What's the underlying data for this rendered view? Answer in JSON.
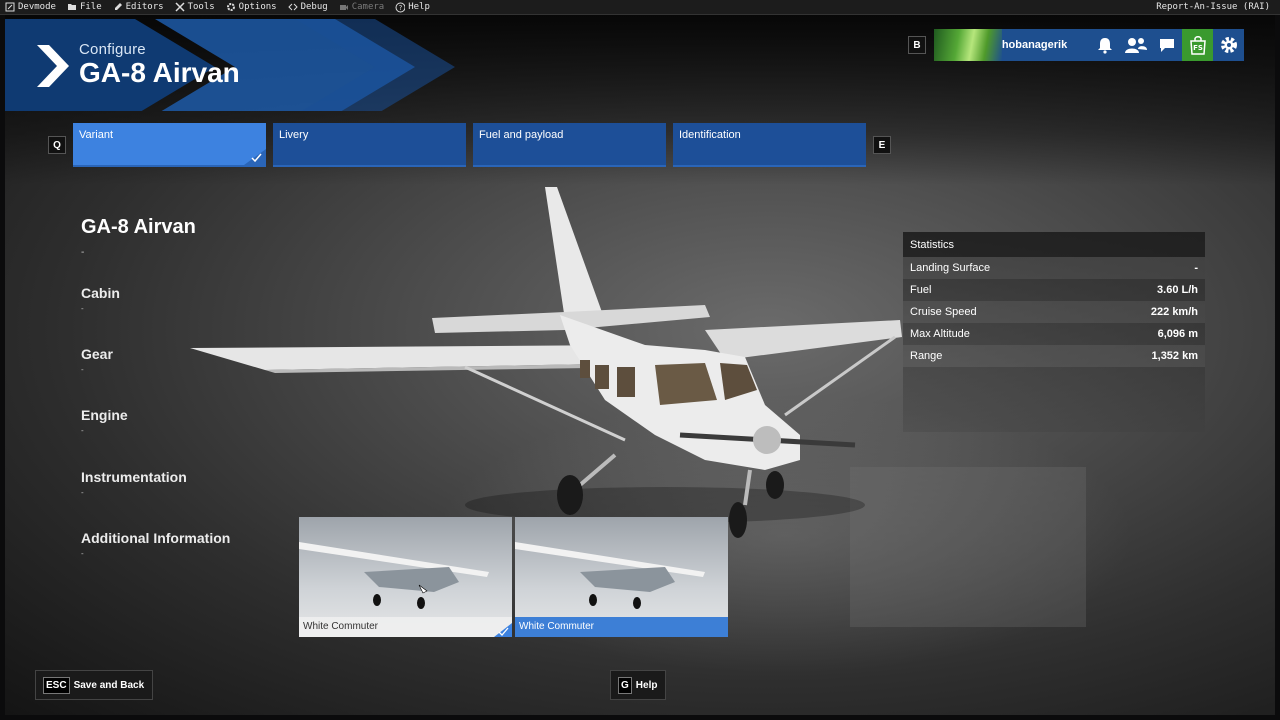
{
  "devbar": {
    "menus": [
      {
        "icon": "devmode-icon",
        "label": "Devmode",
        "enabled": true
      },
      {
        "icon": "folder-icon",
        "label": "File",
        "enabled": true
      },
      {
        "icon": "pencil-icon",
        "label": "Editors",
        "enabled": true
      },
      {
        "icon": "tools-icon",
        "label": "Tools",
        "enabled": true
      },
      {
        "icon": "gear-icon",
        "label": "Options",
        "enabled": true
      },
      {
        "icon": "code-icon",
        "label": "Debug",
        "enabled": true
      },
      {
        "icon": "camera-icon",
        "label": "Camera",
        "enabled": false
      },
      {
        "icon": "question-icon",
        "label": "Help",
        "enabled": true
      }
    ],
    "report": "Report-An-Issue (RAI)"
  },
  "header": {
    "subtitle": "Configure",
    "title": "GA-8 Airvan"
  },
  "userbar": {
    "key": "B",
    "username": "hobanagerik"
  },
  "tabs": {
    "prev_key": "Q",
    "next_key": "E",
    "items": [
      {
        "label": "Variant",
        "active": true
      },
      {
        "label": "Livery",
        "active": false
      },
      {
        "label": "Fuel and payload",
        "active": false
      },
      {
        "label": "Identification",
        "active": false
      }
    ]
  },
  "details": {
    "aircraft_name": "GA-8 Airvan",
    "aircraft_value": "-",
    "sections": [
      {
        "label": "Cabin",
        "value": "-"
      },
      {
        "label": "Gear",
        "value": "-"
      },
      {
        "label": "Engine",
        "value": "-"
      },
      {
        "label": "Instrumentation",
        "value": "-"
      },
      {
        "label": "Additional Information",
        "value": "-"
      }
    ]
  },
  "statistics": {
    "title": "Statistics",
    "rows": [
      {
        "label": "Landing Surface",
        "value": "-"
      },
      {
        "label": "Fuel",
        "value": "3.60 L/h"
      },
      {
        "label": "Cruise Speed",
        "value": "222 km/h"
      },
      {
        "label": "Max Altitude",
        "value": "6,096 m"
      },
      {
        "label": "Range",
        "value": "1,352 km"
      }
    ]
  },
  "liveries": [
    {
      "label": "White Commuter",
      "checked": true,
      "highlighted": false
    },
    {
      "label": "White Commuter",
      "checked": false,
      "highlighted": true
    }
  ],
  "footer": {
    "back_key": "ESC",
    "back_label": "Save and Back",
    "help_key": "G",
    "help_label": "Help"
  },
  "colors": {
    "accent_blue": "#1d4f98",
    "active_blue": "#3d82e0",
    "shop_green": "#3a9a2e"
  }
}
